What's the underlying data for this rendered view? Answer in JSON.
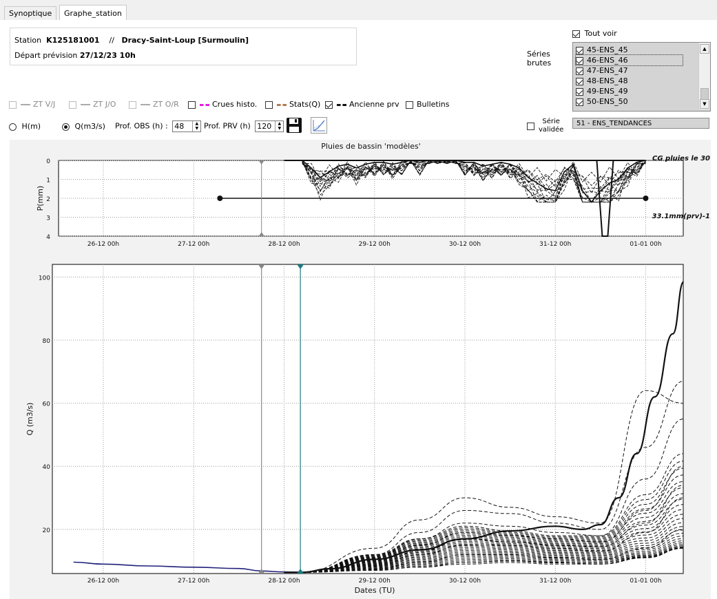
{
  "tabs": [
    {
      "label": "Synoptique"
    },
    {
      "label": "Graphe_station"
    }
  ],
  "station": {
    "label": "Station",
    "code": "K125181001",
    "sep": "//",
    "name": "Dracy-Saint-Loup [Surmoulin]",
    "depart_label": "Départ prévision",
    "depart_value": "27/12/23 10h"
  },
  "options": [
    {
      "label": "ZT V/J",
      "checked": false,
      "disabled": true,
      "legend_color": "#aaaaaa"
    },
    {
      "label": "ZT J/O",
      "checked": false,
      "disabled": true,
      "legend_color": "#aaaaaa"
    },
    {
      "label": "ZT O/R",
      "checked": false,
      "disabled": true,
      "legend_color": "#aaaaaa"
    },
    {
      "label": "Crues histo.",
      "checked": false,
      "disabled": false,
      "legend_color": "#e020e0"
    },
    {
      "label": "Stats(Q)",
      "checked": false,
      "disabled": false,
      "legend_color": "#b07a50"
    },
    {
      "label": "Ancienne prv",
      "checked": true,
      "disabled": false,
      "legend_color": "#111111"
    },
    {
      "label": "Bulletins",
      "checked": false,
      "disabled": false,
      "legend_color": ""
    }
  ],
  "mode": {
    "h_label": "H(m)",
    "q_label": "Q(m3/s)",
    "selected": "Q(m3/s)"
  },
  "prof_obs": {
    "label": "Prof. OBS (h) :",
    "value": "48"
  },
  "prof_prv": {
    "label": "Prof. PRV (h)",
    "value": "120"
  },
  "tout_voir": {
    "label": "Tout voir",
    "checked": true
  },
  "series_brutes_label": [
    "Séries",
    "brutes"
  ],
  "series_list": [
    {
      "label": "45-ENS_45",
      "checked": true,
      "selected": false
    },
    {
      "label": "46-ENS_46",
      "checked": true,
      "selected": true
    },
    {
      "label": "47-ENS_47",
      "checked": true,
      "selected": false
    },
    {
      "label": "48-ENS_48",
      "checked": true,
      "selected": false
    },
    {
      "label": "49-ENS_49",
      "checked": true,
      "selected": false
    },
    {
      "label": "50-ENS_50",
      "checked": true,
      "selected": false
    }
  ],
  "serie_validee": {
    "label_line1": "Série",
    "label_line2": "validée",
    "checked": false,
    "value": "51 - ENS_TENDANCES"
  },
  "chart_data": [
    {
      "type": "line",
      "title": "Pluies de bassin 'modèles'",
      "ylabel": "P(mm)",
      "ylim": [
        0,
        4
      ],
      "y_inverted": true,
      "yticks": [
        "0",
        "1",
        "2",
        "3",
        "4"
      ],
      "xticks": [
        "26-12 00h",
        "27-12 00h",
        "28-12 00h",
        "29-12 00h",
        "30-12 00h",
        "31-12 00h",
        "01-01 00h"
      ],
      "grid": true,
      "annotations": [
        "CG pluies le 30",
        "33.1mm(prv)-1"
      ],
      "cumul_line": {
        "x": [
          "27-12 07h",
          "01-01 00h"
        ],
        "y": 2
      },
      "series": [
        {
          "x": [
            2.2,
            2.3,
            2.4,
            2.5,
            2.6,
            2.7,
            2.8,
            2.9,
            3.0,
            3.1,
            3.2,
            3.3,
            3.4,
            3.5,
            3.6,
            3.7,
            3.8,
            3.9,
            4.0,
            4.1,
            4.2,
            4.3,
            4.4,
            4.5,
            4.6,
            4.7,
            4.8,
            4.9,
            5.0,
            5.1,
            5.2,
            5.3,
            5.4,
            5.5,
            5.6,
            5.7,
            5.8,
            5.9,
            6.0
          ],
          "values": [
            0,
            0.4,
            0.9,
            0.6,
            0.3,
            0.2,
            0.4,
            0.2,
            0.1,
            0.1,
            0.2,
            0.1,
            0,
            0.1,
            0,
            0,
            0,
            0,
            0.1,
            0.1,
            0.3,
            0.2,
            0.1,
            0.2,
            0.4,
            0.9,
            1.2,
            1.5,
            1.6,
            0.6,
            0.2,
            1.6,
            2.2,
            1.6,
            1.2,
            1.0,
            0.4,
            0.1,
            0
          ]
        }
      ]
    },
    {
      "type": "line",
      "ylabel": "Q (m3/s)",
      "xlabel": "Dates (TU)",
      "ylim": [
        6,
        104
      ],
      "yticks": [
        "20",
        "40",
        "60",
        "80",
        "100"
      ],
      "xticks": [
        "26-12 00h",
        "27-12 00h",
        "28-12 00h",
        "29-12 00h",
        "30-12 00h",
        "31-12 00h",
        "01-01 00h"
      ],
      "grid": true,
      "series": [
        {
          "name": "",
          "color": "#1f1f7a",
          "style": "solid",
          "x": [
            -0.33,
            0.0,
            0.5,
            1.0,
            1.5,
            1.75,
            2.0,
            2.2
          ],
          "values": [
            9.6,
            9.0,
            8.4,
            8.0,
            7.6,
            6.8,
            6.5,
            6.4
          ]
        },
        {
          "name": "",
          "color": "#111111",
          "style": "solid-bold",
          "x": [
            2.0,
            2.2,
            2.5,
            3.0,
            3.5,
            4.0,
            4.5,
            5.0,
            5.3,
            5.5,
            5.7,
            5.9,
            6.1,
            6.3,
            6.42
          ],
          "values": [
            6.4,
            6.4,
            7.5,
            10.5,
            13.5,
            17.0,
            19.5,
            21.0,
            20.0,
            21.5,
            30.0,
            44.0,
            62.0,
            82.0,
            98.5
          ]
        },
        {
          "name": "",
          "color": "#111111",
          "style": "dashed",
          "x": [
            2.2,
            3.0,
            3.5,
            4.0,
            4.5,
            5.0,
            5.5,
            6.0,
            6.42
          ],
          "values": [
            6.4,
            14.0,
            23.0,
            30.0,
            27.0,
            24.0,
            22.0,
            64.0,
            60.0
          ]
        },
        {
          "name": "",
          "color": "#111111",
          "style": "dashed",
          "x": [
            2.2,
            3.0,
            3.5,
            4.0,
            4.5,
            5.0,
            5.5,
            6.0,
            6.42
          ],
          "values": [
            6.4,
            12.0,
            19.0,
            26.0,
            25.0,
            22.0,
            20.0,
            46.0,
            67.0
          ]
        },
        {
          "name": "",
          "color": "#111111",
          "style": "dashed",
          "x": [
            2.2,
            3.0,
            3.5,
            4.0,
            4.5,
            5.0,
            5.5,
            6.0,
            6.42
          ],
          "values": [
            6.4,
            10.0,
            15.0,
            19.0,
            18.0,
            17.0,
            16.0,
            26.0,
            40.0
          ]
        },
        {
          "name": "",
          "color": "#111111",
          "style": "dashed",
          "x": [
            2.2,
            3.0,
            3.5,
            4.0,
            4.5,
            5.0,
            5.5,
            6.0,
            6.42
          ],
          "values": [
            6.4,
            8.5,
            12.0,
            15.0,
            15.0,
            14.0,
            13.0,
            19.0,
            30.0
          ]
        },
        {
          "name": "",
          "color": "#111111",
          "style": "dashed",
          "x": [
            2.2,
            3.0,
            3.5,
            4.0,
            4.5,
            5.0,
            5.5,
            6.0,
            6.42
          ],
          "values": [
            6.4,
            7.5,
            9.5,
            12.0,
            12.0,
            11.0,
            10.5,
            14.0,
            20.0
          ]
        },
        {
          "name": "",
          "color": "#111111",
          "style": "dashed",
          "x": [
            2.2,
            3.0,
            3.5,
            4.0,
            4.5,
            5.0,
            5.5,
            6.0,
            6.42
          ],
          "values": [
            6.4,
            7.0,
            8.0,
            9.5,
            10.0,
            9.5,
            9.0,
            11.0,
            14.0
          ]
        },
        {
          "name": "",
          "color": "#111111",
          "style": "dashed",
          "x": [
            2.2,
            3.0,
            3.5,
            4.0,
            4.5,
            5.0,
            5.5,
            6.0,
            6.42
          ],
          "values": [
            6.4,
            11.0,
            17.0,
            22.0,
            21.0,
            19.0,
            18.0,
            36.0,
            55.0
          ]
        },
        {
          "name": "",
          "color": "#111111",
          "style": "dashed",
          "x": [
            2.2,
            3.0,
            3.5,
            4.0,
            4.5,
            5.0,
            5.5,
            6.0,
            6.42
          ],
          "values": [
            6.4,
            9.0,
            13.0,
            17.0,
            16.0,
            15.0,
            14.5,
            22.0,
            34.0
          ]
        }
      ],
      "markers": [
        {
          "label": "",
          "x": 1.75,
          "color": "#888888"
        },
        {
          "label": "",
          "x": 2.18,
          "color": "#1a7a80"
        }
      ]
    }
  ]
}
